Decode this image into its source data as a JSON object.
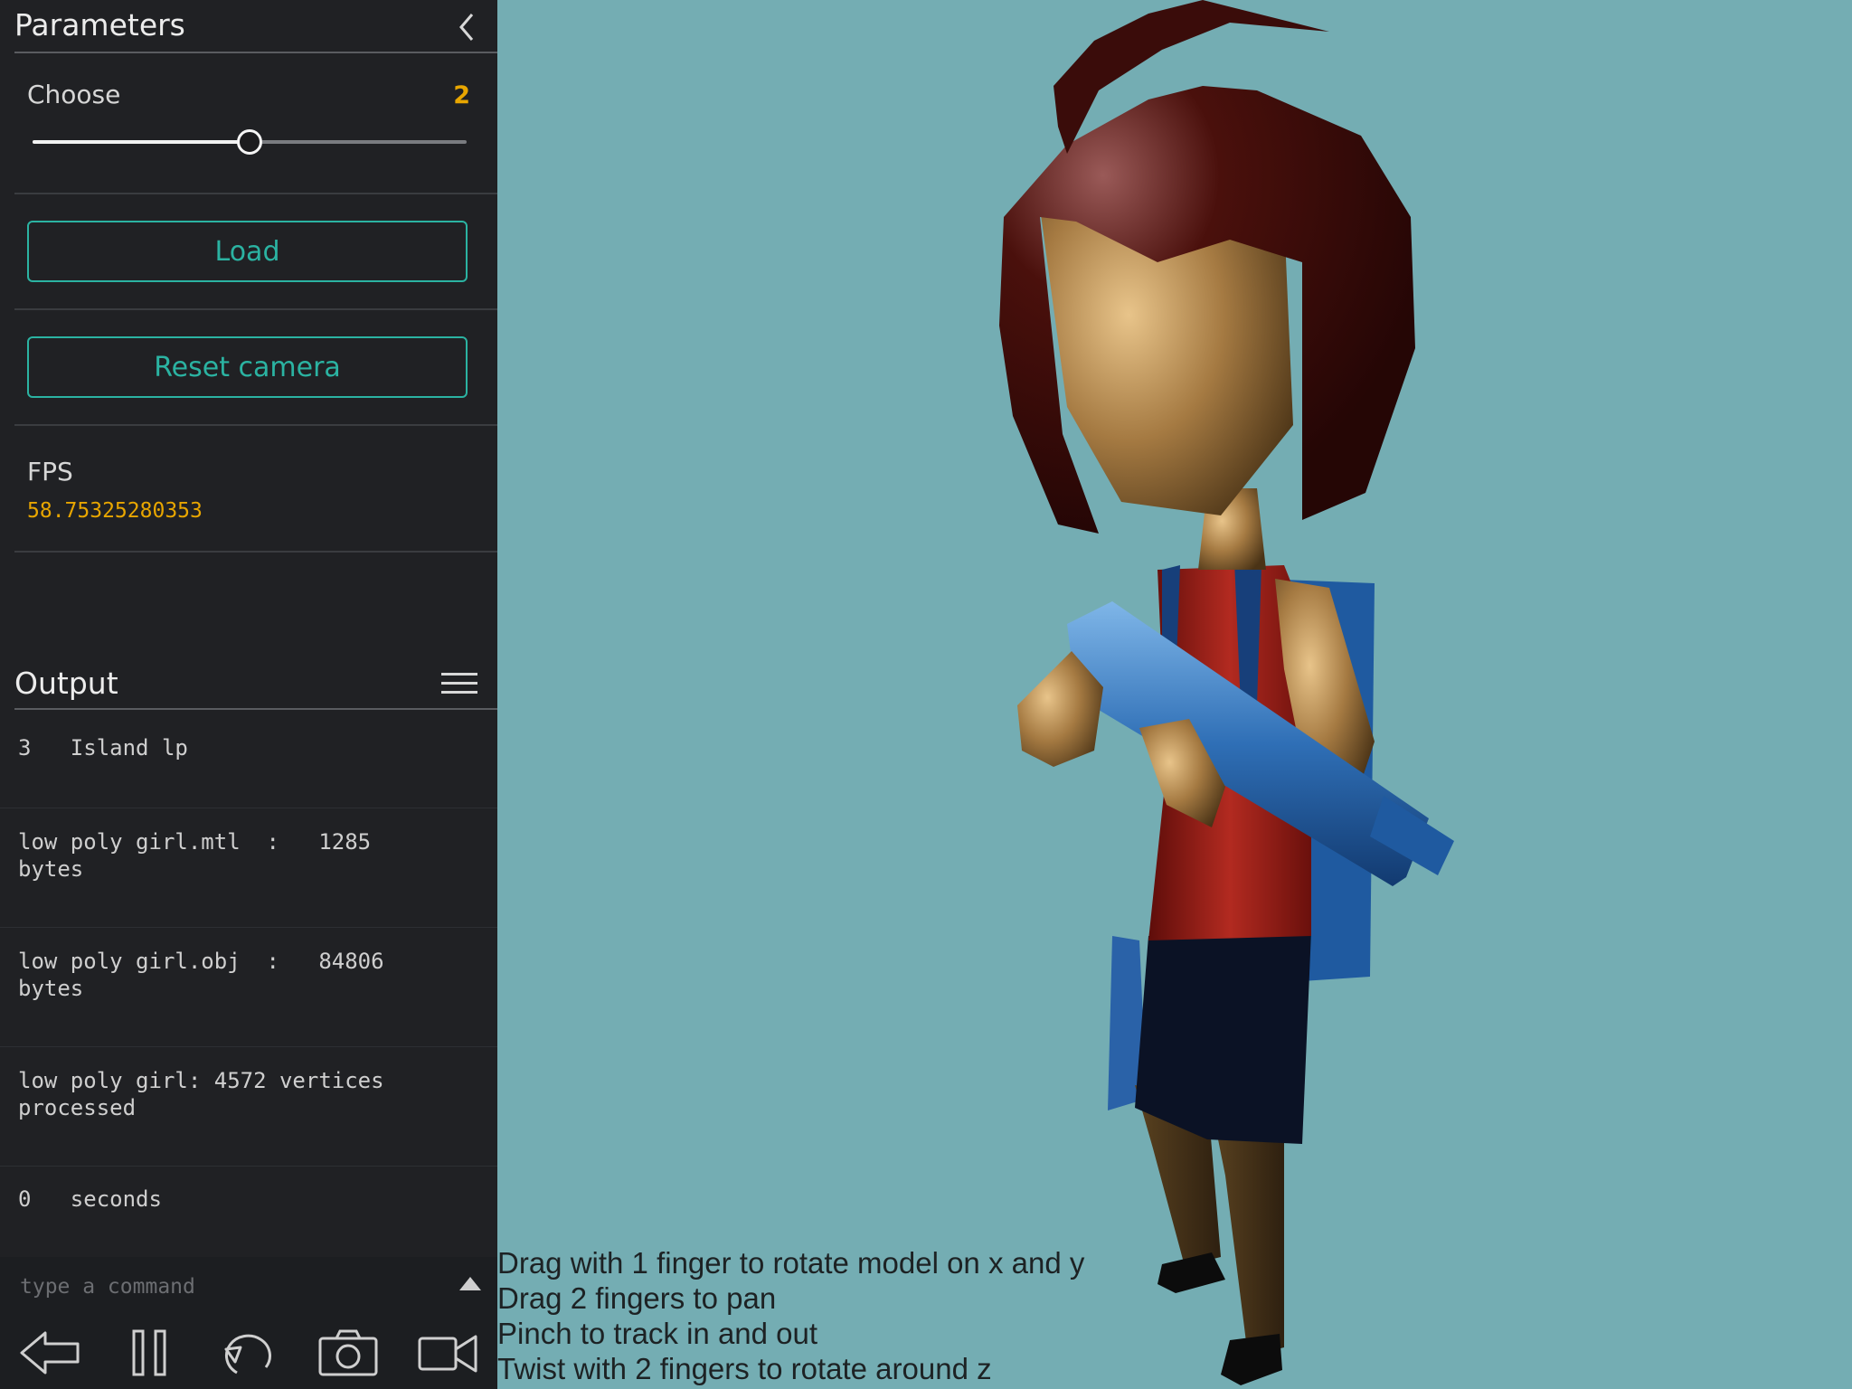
{
  "parameters": {
    "title": "Parameters",
    "slider": {
      "label": "Choose",
      "value": "2",
      "level": 0.5
    },
    "load_label": "Load",
    "reset_label": "Reset camera",
    "fps_label": "FPS",
    "fps_value": "58.75325280353"
  },
  "output": {
    "title": "Output",
    "lines": [
      "3   Island lp",
      "low poly girl.mtl  :   1285\nbytes",
      "low poly girl.obj  :   84806\nbytes",
      "low poly girl: 4572 vertices\nprocessed",
      "0   seconds"
    ]
  },
  "command": {
    "placeholder": "type a command"
  },
  "toolbar": [
    "back-icon",
    "pause-icon",
    "reload-icon",
    "camera-icon",
    "video-icon"
  ],
  "hints": [
    "Drag with 1 finger to rotate model on x and y",
    "Drag 2 fingers to pan",
    "Pinch to track in and out",
    "Twist with 2 fingers to rotate around z"
  ],
  "colors": {
    "accent": "#2bb3a2",
    "value": "#e8a600",
    "background": "#74adb3"
  }
}
